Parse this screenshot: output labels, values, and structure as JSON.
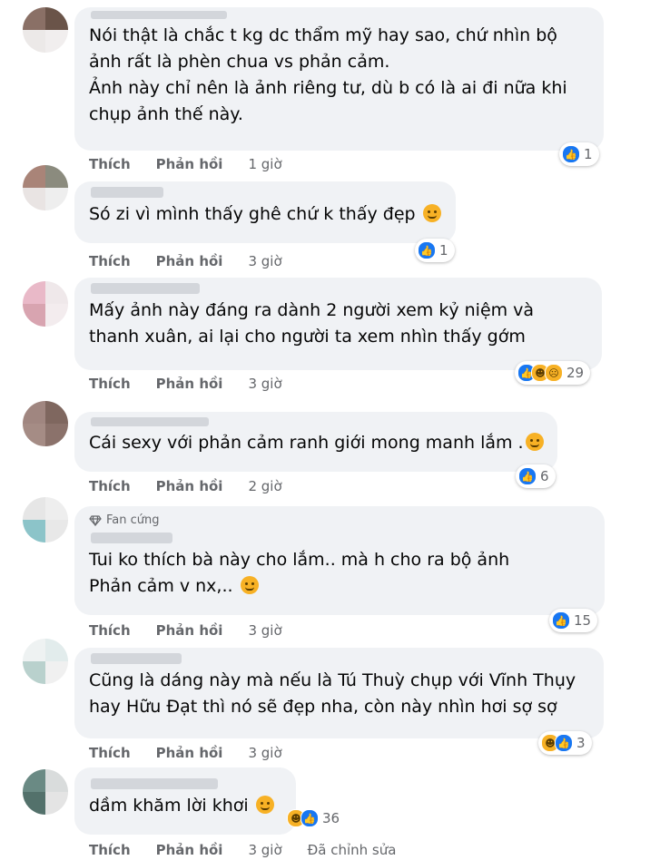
{
  "labels": {
    "like": "Thích",
    "reply": "Phản hồi"
  },
  "comments": [
    {
      "text": "Nói thật là chắc t kg dc thẩm mỹ hay sao, chứ nhìn bộ\nảnh rất là phèn chua vs phản cảm.\nẢnh này chỉ nên là ảnh riêng tư, dù b có là ai đi nữa khi\nchụp ảnh thế này.",
      "reactions": [
        "like"
      ],
      "count": "1",
      "time": "1 giờ"
    },
    {
      "text": "Só zi vì mình thấy ghê chứ k thấy đẹp",
      "reactions": [
        "like"
      ],
      "count": "1",
      "time": "3 giờ"
    },
    {
      "text": "Mấy ảnh này đáng ra dành 2 người xem kỷ niệm và\nthanh xuân, ai lại cho người ta xem nhìn thấy gớm",
      "reactions": [
        "like",
        "haha",
        "sad"
      ],
      "count": "29",
      "time": "3 giờ"
    },
    {
      "text": "Cái sexy với phản cảm ranh giới mong manh lắm .",
      "reactions": [
        "like"
      ],
      "count": "6",
      "time": "2 giờ"
    },
    {
      "badge": "Fan cứng",
      "text": "Tui ko thích bà này cho lắm..  mà h cho ra bộ ảnh\nPhản cảm v nx,.. ",
      "reactions": [
        "like"
      ],
      "count": "15",
      "time": "3 giờ"
    },
    {
      "text": "Cũng là dáng này mà nếu là Tú Thuỳ chụp với Vĩnh Thụy\nhay Hữu Đạt thì nó sẽ đẹp nha, còn này nhìn hơi sợ sợ",
      "reactions": [
        "haha",
        "like"
      ],
      "count": "3",
      "time": "3 giờ"
    },
    {
      "text": "dầm khăm lời khơi ",
      "reactions": [
        "haha",
        "like"
      ],
      "count": "36",
      "time": "3 giờ",
      "edited": "Đã chỉnh sửa"
    }
  ],
  "colors": {
    "bubble": "#f0f2f5",
    "like_blue": "#1877f2",
    "secondary_text": "#65676b",
    "reaction_yellow": "#f7b125"
  }
}
